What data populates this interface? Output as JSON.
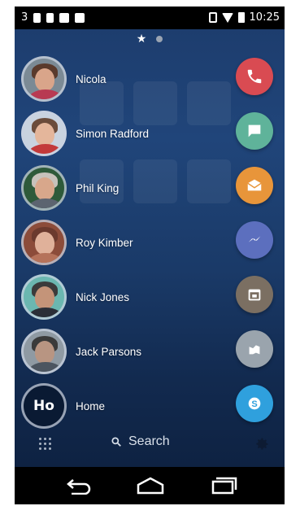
{
  "status_bar": {
    "left_text": "3",
    "icons_left": [
      "signal-icon",
      "sim-icon",
      "flipboard-icon",
      "briefcase-icon"
    ],
    "icons_right": [
      "vibrate-icon",
      "wifi-icon",
      "battery-icon"
    ],
    "time": "10:25"
  },
  "page_indicator": {
    "icons": [
      "star-icon",
      "page-dot-icon"
    ]
  },
  "contacts": [
    {
      "name": "Nicola",
      "initials": ""
    },
    {
      "name": "Simon Radford",
      "initials": ""
    },
    {
      "name": "Phil King",
      "initials": ""
    },
    {
      "name": "Roy Kimber",
      "initials": ""
    },
    {
      "name": "Nick Jones",
      "initials": ""
    },
    {
      "name": "Jack Parsons",
      "initials": ""
    },
    {
      "name": "Home",
      "initials": "Ho"
    }
  ],
  "actions": [
    {
      "name": "phone",
      "icon": "phone-icon",
      "color": "#d94b52"
    },
    {
      "name": "sms",
      "icon": "message-icon",
      "color": "#5fb39a"
    },
    {
      "name": "email",
      "icon": "email-icon",
      "color": "#e8953a"
    },
    {
      "name": "messenger",
      "icon": "messenger-icon",
      "color": "#5c6fbe"
    },
    {
      "name": "calendar",
      "icon": "calendar-icon",
      "color": "#7b6f62"
    },
    {
      "name": "maps",
      "icon": "map-icon",
      "color": "#9aa4ad"
    },
    {
      "name": "skype",
      "icon": "skype-icon",
      "color": "#2fa0dd"
    }
  ],
  "bottom_bar": {
    "search_label": "Search",
    "icons": [
      "keypad-icon",
      "search-icon",
      "settings-icon"
    ]
  },
  "nav_bar": {
    "icons": [
      "back-icon",
      "home-icon",
      "recents-icon"
    ]
  }
}
